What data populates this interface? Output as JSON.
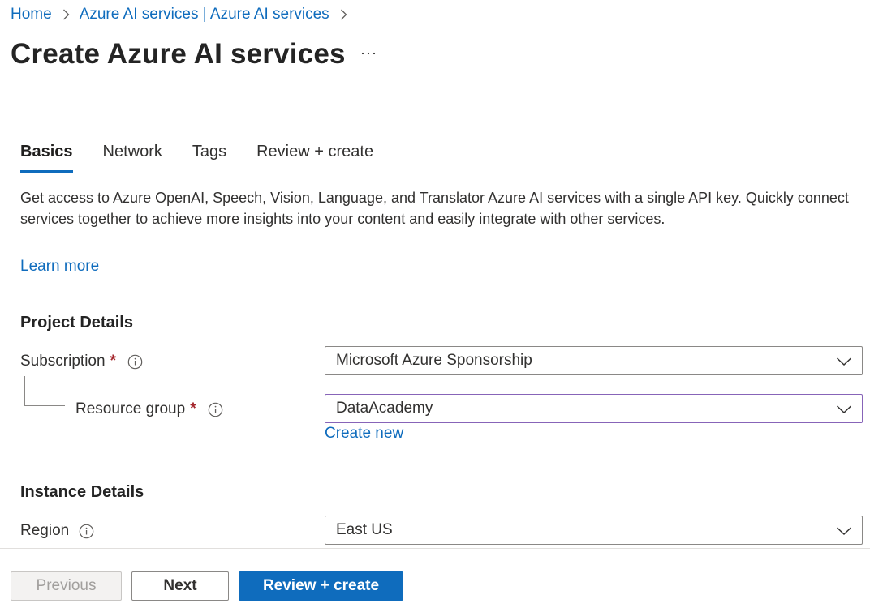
{
  "breadcrumb": {
    "items": [
      "Home",
      "Azure AI services | Azure AI services"
    ]
  },
  "page": {
    "title": "Create Azure AI services"
  },
  "tabs": [
    {
      "label": "Basics",
      "active": true
    },
    {
      "label": "Network",
      "active": false
    },
    {
      "label": "Tags",
      "active": false
    },
    {
      "label": "Review + create",
      "active": false
    }
  ],
  "basics": {
    "description": "Get access to Azure OpenAI, Speech, Vision, Language, and Translator Azure AI services with a single API key. Quickly connect services together to achieve more insights into your content and easily integrate with other services.",
    "learn_more": "Learn more",
    "project_details": {
      "heading": "Project Details",
      "subscription": {
        "label": "Subscription",
        "required_marker": "*",
        "value": "Microsoft Azure Sponsorship"
      },
      "resource_group": {
        "label": "Resource group",
        "required_marker": "*",
        "value": "DataAcademy",
        "create_new": "Create new"
      }
    },
    "instance_details": {
      "heading": "Instance Details",
      "region": {
        "label": "Region",
        "value": "East US"
      }
    }
  },
  "footer": {
    "previous": "Previous",
    "next": "Next",
    "review_create": "Review + create"
  },
  "colors": {
    "accent": "#0f6cbd",
    "required": "#a4262c",
    "focus_border": "#8764b8"
  },
  "icons": {
    "breadcrumb_separator": "chevron-right-icon",
    "more": "ellipsis-icon",
    "info": "info-icon",
    "dropdown": "chevron-down-icon"
  }
}
